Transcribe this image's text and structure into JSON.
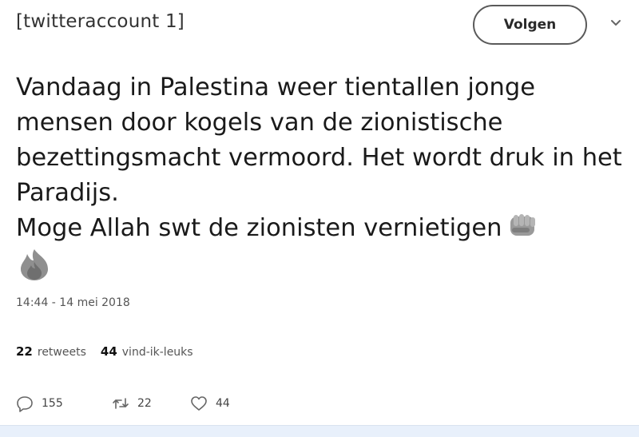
{
  "tweet": {
    "account": "[twitteraccount 1]",
    "follow_label": "Volgen",
    "text_lines": [
      "Vandaag in Palestina weer tientallen jonge mensen door kogels van de zionistische bezettingsmacht vermoord. Het wordt druk in het Paradijs.",
      "Moge Allah swt de zionisten vernietigen"
    ],
    "emojis": [
      "fist-emoji",
      "fire-emoji"
    ],
    "timestamp": "14:44 - 14 mei 2018",
    "stats": {
      "retweets_count": "22",
      "retweets_label": "retweets",
      "likes_count": "44",
      "likes_label": "vind-ik-leuks"
    },
    "actions": {
      "reply_count": "155",
      "retweet_count": "22",
      "like_count": "44"
    }
  },
  "icons": [
    "chevron-down-icon",
    "reply-icon",
    "retweet-icon",
    "heart-icon"
  ],
  "colors": {
    "text": "#1a1a1a",
    "muted": "#555555",
    "bottom_bar": "#e8f0fb"
  }
}
